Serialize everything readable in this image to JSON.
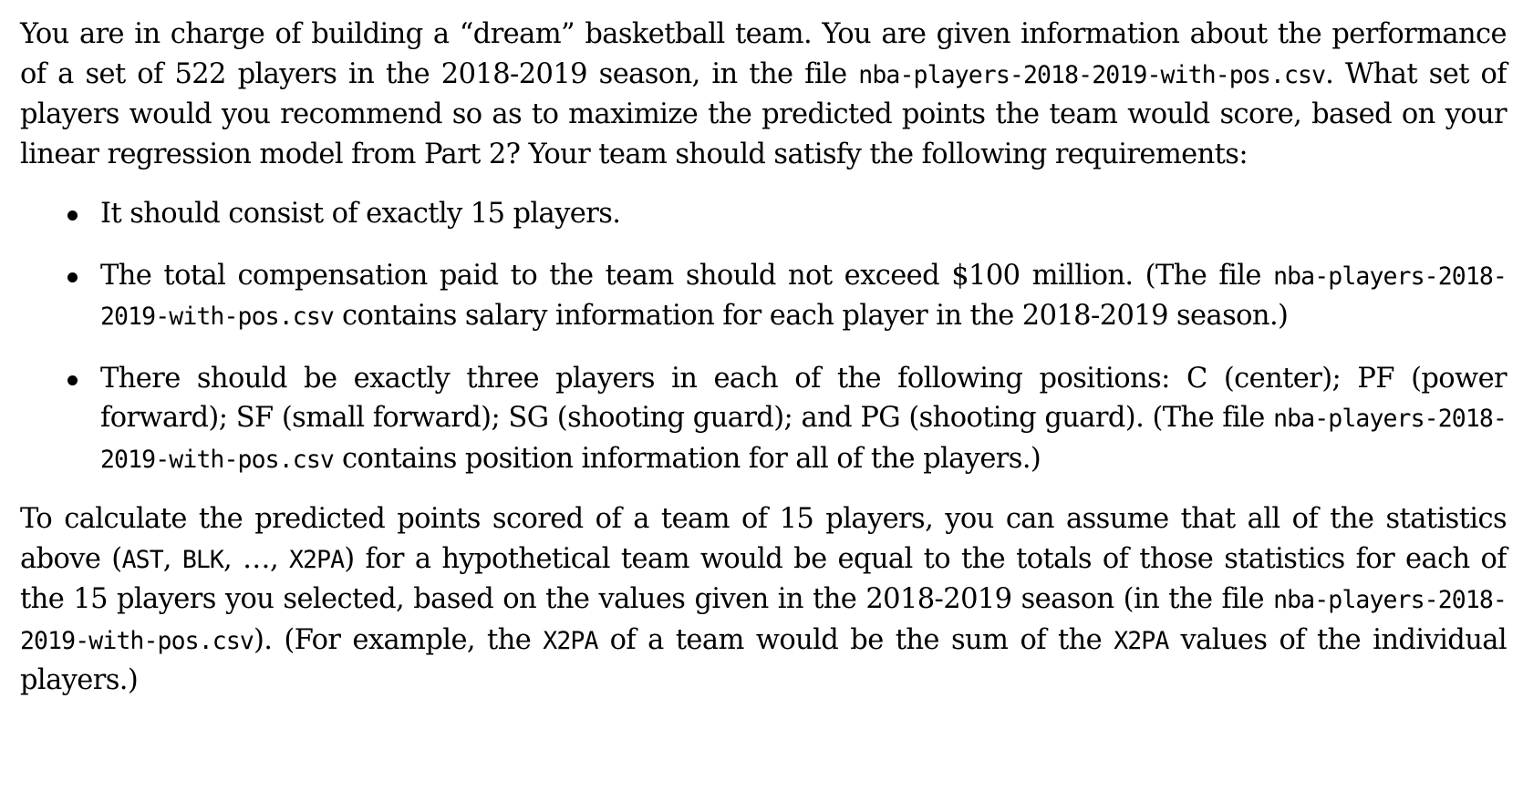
{
  "intro": {
    "t1": "You are in charge of building a “dream” basketball team. You are given information about the performance of a set of 522 players in the 2018-2019 season, in the file ",
    "file": "nba-players-2018-2019-with-pos.csv",
    "t2": ". What set of players would you recommend so as to maximize the predicted points the team would score, based on your linear regression model from Part 2? Your team should satisfy the following requirements:"
  },
  "requirements": [
    {
      "t1": "It should consist of exactly 15 players."
    },
    {
      "t1": "The total compensation paid to the team should not exceed $100 million. (The file ",
      "file": "nba-players-2018-2019-with-pos.csv",
      "t2": " contains salary information for each player in the 2018-2019 season.)"
    },
    {
      "t1": "There should be exactly three players in each of the following positions: C (center); PF (power forward); SF (small forward); SG (shooting guard); and PG (shooting guard). (The file ",
      "file": "nba-players-2018-2019-with-pos.csv",
      "t2": " contains position information for all of the players.)"
    }
  ],
  "closing": {
    "t1": "To calculate the predicted points scored of a team of 15 players, you can assume that all of the statistics above (",
    "stat_ast": "AST",
    "t2": ", ",
    "stat_blk": "BLK",
    "t3": ", …, ",
    "stat_x2pa_1": "X2PA",
    "t4": ") for a hypothetical team would be equal to the totals of those statistics for each of the 15 players you selected, based on the values given in the 2018-2019 season (in the file ",
    "file": "nba-players-2018-2019-with-pos.csv",
    "t5": "). (For example, the ",
    "stat_x2pa_2": "X2PA",
    "t6": " of a team would be the sum of the ",
    "stat_x2pa_3": "X2PA",
    "t7": " values of the individual players.)"
  }
}
